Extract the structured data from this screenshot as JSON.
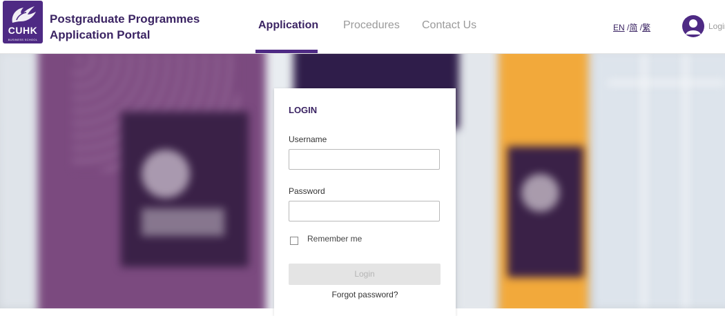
{
  "header": {
    "logo": {
      "text": "CUHK",
      "subtext": "BUSINESS SCHOOL"
    },
    "title_line1": "Postgraduate Programmes",
    "title_line2": "Application Portal",
    "tabs": [
      {
        "label": "Application",
        "active": true
      },
      {
        "label": "Procedures",
        "active": false
      },
      {
        "label": "Contact Us",
        "active": false
      }
    ],
    "languages": [
      "EN",
      "简",
      "繁"
    ],
    "language_separator": "/",
    "login_link": "Login"
  },
  "login_card": {
    "title": "LOGIN",
    "username_label": "Username",
    "username_value": "",
    "password_label": "Password",
    "password_value": "",
    "remember_label": "Remember me",
    "login_button": "Login",
    "forgot_link": "Forgot password?"
  },
  "colors": {
    "brand_purple": "#4e2a84",
    "title_purple": "#3b2463",
    "accent_yellow": "#f2a93b"
  },
  "icons": {
    "avatar": "user-avatar-icon",
    "logo": "cuhk-phoenix-logo"
  }
}
